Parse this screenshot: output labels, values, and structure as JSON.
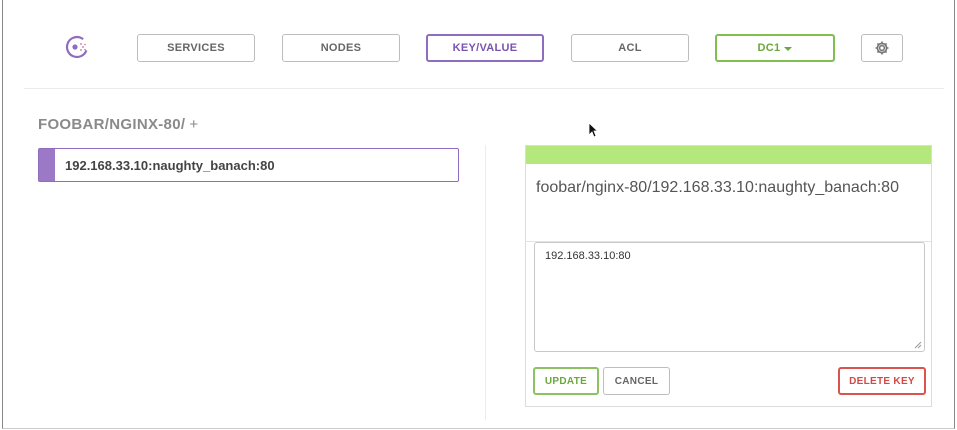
{
  "nav": {
    "services": "SERVICES",
    "nodes": "NODES",
    "key_value": "KEY/VALUE",
    "acl": "ACL",
    "datacenter": "DC1"
  },
  "breadcrumb": {
    "path": "FOOBAR/NGINX-80/",
    "add": "+"
  },
  "keys": [
    {
      "label": "192.168.33.10:naughty_banach:80",
      "selected": true
    }
  ],
  "editor": {
    "title": "foobar/nginx-80/192.168.33.10:naughty_banach:80",
    "value": "192.168.33.10:80",
    "update_label": "UPDATE",
    "cancel_label": "CANCEL",
    "delete_label": "DELETE KEY"
  },
  "colors": {
    "accent_purple": "#8e6dbf",
    "accent_green": "#7fbe4f",
    "status_bar": "#b5e87c",
    "danger": "#d9534f"
  }
}
